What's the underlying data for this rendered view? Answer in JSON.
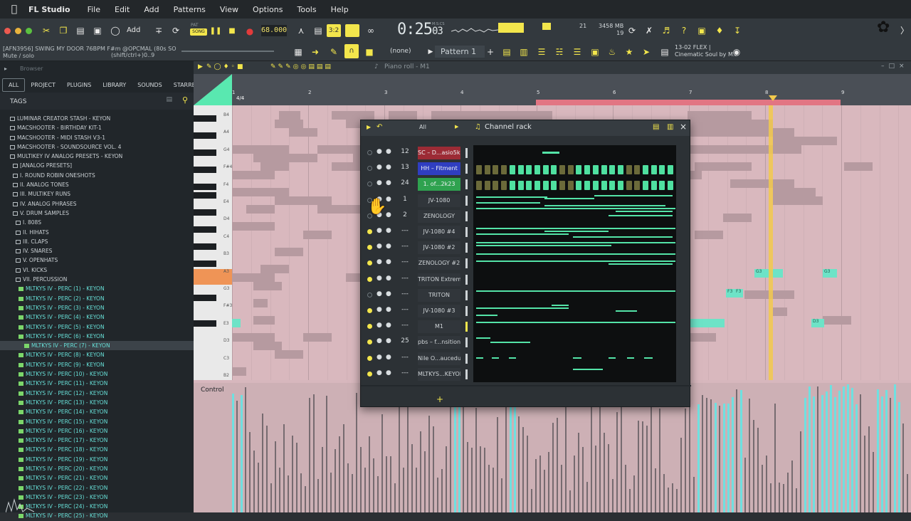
{
  "menu": {
    "apple": "",
    "app": "FL Studio",
    "items": [
      "File",
      "Edit",
      "Add",
      "Patterns",
      "View",
      "Options",
      "Tools",
      "Help"
    ]
  },
  "toolbar": {
    "add_label": "Add",
    "song_label": "SONG",
    "pat_label": "PAT",
    "tempo": "68.000",
    "time": "0:25",
    "time_sub": "03",
    "time_unit": "M:S:CS",
    "cpu": "21",
    "mem": "3458 MB",
    "voices": "19",
    "hint_line1": "[AFN3956] SWING MY DOOR 76BPM F#m @OPCMAL (80s SO",
    "hint_line2": "Mute / solo",
    "hint_shortcut": "(shift/ctrl+)0..9",
    "snap": "(none)",
    "pattern": "Pattern 1",
    "flex_line1": "13-02  FLEX |",
    "flex_line2": "Cinematic Soul by M..",
    "beat_3_2": "3:2"
  },
  "browser": {
    "title": "Browser",
    "tabs": [
      "ALL",
      "PROJECT",
      "PLUGINS",
      "LIBRARY",
      "SOUNDS",
      "STARRED"
    ],
    "tags": "TAGS",
    "folders": [
      "LUMINAR CREATOR STASH - KEYON",
      "MACSHOOTER - BIRTHDAY KIT-1",
      "MACSHOOTER - MIDI STASH V3-1",
      "MACSHOOTER - SOUNDSOURCE VOL. 4",
      "MULTIKEY IV ANALOG PRESETS - KEYON",
      "[ANALOG PRESETS]",
      "I. ROUND ROBIN ONESHOTS",
      "II. ANALOG TONES",
      "III. MULTIKEY RUNS",
      "IV. ANALOG PHRASES",
      "V. DRUM SAMPLES",
      "I. 808S",
      "II. HIHATS",
      "III. CLAPS",
      "IV. SNARES",
      "V. OPENHATS",
      "VI. KICKS",
      "VII. PERCUSSION"
    ],
    "files": [
      "MLTKYS IV - PERC (1) - KEYON",
      "MLTKYS IV - PERC (2) - KEYON",
      "MLTKYS IV - PERC (3) - KEYON",
      "MLTKYS IV - PERC (4) - KEYON",
      "MLTKYS IV - PERC (5) - KEYON",
      "MLTKYS IV - PERC (6) - KEYON",
      "MLTKYS IV - PERC (7) - KEYON",
      "MLTKYS IV - PERC (8) - KEYON",
      "MLTKYS IV - PERC (9) - KEYON",
      "MLTKYS IV - PERC (10) - KEYON",
      "MLTKYS IV - PERC (11) - KEYON",
      "MLTKYS IV - PERC (12) - KEYON",
      "MLTKYS IV - PERC (13) - KEYON",
      "MLTKYS IV - PERC (14) - KEYON",
      "MLTKYS IV - PERC (15) - KEYON",
      "MLTKYS IV - PERC (16) - KEYON",
      "MLTKYS IV - PERC (17) - KEYON",
      "MLTKYS IV - PERC (18) - KEYON",
      "MLTKYS IV - PERC (19) - KEYON",
      "MLTKYS IV - PERC (20) - KEYON",
      "MLTKYS IV - PERC (21) - KEYON",
      "MLTKYS IV - PERC (22) - KEYON",
      "MLTKYS IV - PERC (23) - KEYON",
      "MLTKYS IV - PERC (24) - KEYON",
      "MLTKYS IV - PERC (25) - KEYON"
    ]
  },
  "pianoroll": {
    "title": "Piano roll - M1",
    "time_sig": "4/4",
    "bars": [
      "1",
      "2",
      "3",
      "4",
      "5",
      "6",
      "7",
      "8",
      "9"
    ],
    "keys": [
      "B4",
      "A4",
      "G4",
      "F#4",
      "F4",
      "E4",
      "D4",
      "C4",
      "B3",
      "A3",
      "G3",
      "F#3",
      "E3",
      "D3",
      "C3",
      "B2",
      "A2"
    ],
    "note_labels": [
      "G3",
      "G3",
      "F3",
      "F3",
      "D3",
      "D3"
    ],
    "control_label": "Control"
  },
  "rack": {
    "title": "Channel rack",
    "filter": "All",
    "add": "+",
    "close": "×",
    "channels": [
      {
        "num": "12",
        "name": "SC – D...asio5k)",
        "color": "#9c2b35",
        "on": false
      },
      {
        "num": "13",
        "name": "HH – Fitment",
        "color": "#2f3ec1",
        "on": false
      },
      {
        "num": "24",
        "name": "1. of...2k23",
        "color": "#2fa24f",
        "on": false
      },
      {
        "num": "1",
        "name": "JV-1080",
        "color": "",
        "on": false
      },
      {
        "num": "2",
        "name": "ZENOLOGY",
        "color": "",
        "on": false
      },
      {
        "num": "---",
        "name": "JV-1080 #4",
        "color": "",
        "on": true
      },
      {
        "num": "---",
        "name": "JV-1080 #2",
        "color": "",
        "on": true
      },
      {
        "num": "---",
        "name": "ZENOLOGY #2",
        "color": "",
        "on": true
      },
      {
        "num": "---",
        "name": "TRITON Extreme",
        "color": "",
        "on": true
      },
      {
        "num": "---",
        "name": "TRITON",
        "color": "",
        "on": false
      },
      {
        "num": "---",
        "name": "JV-1080 #3",
        "color": "",
        "on": true
      },
      {
        "num": "---",
        "name": "M1",
        "color": "",
        "on": true
      },
      {
        "num": "25",
        "name": "pbs – f...nsition]",
        "color": "",
        "on": true
      },
      {
        "num": "---",
        "name": "Nile O...aucedup",
        "color": "",
        "on": true
      },
      {
        "num": "---",
        "name": "MLTKYS...KEYON",
        "color": "",
        "on": true
      }
    ]
  },
  "colors": {
    "accent": "#f3e64c",
    "note_green": "#6de3c7",
    "loop_pink": "#e27583",
    "playhead": "#f2c94c"
  }
}
